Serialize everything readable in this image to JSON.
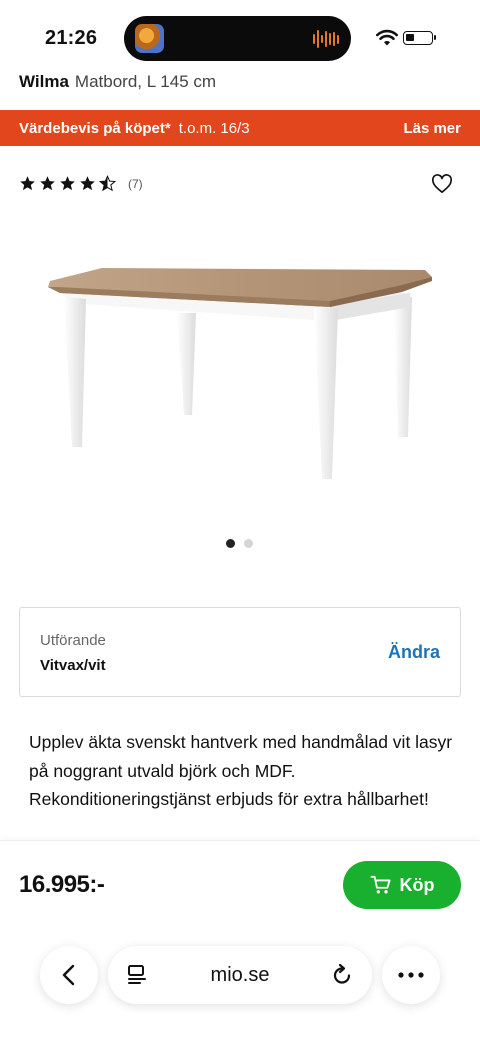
{
  "status_bar": {
    "time": "21:26"
  },
  "product": {
    "brand": "Wilma",
    "name": "Matbord, L 145 cm",
    "rating": 4.5,
    "review_count": "(7)",
    "description": "Upplev äkta svenskt hantverk med handmålad vit lasyr på noggrant utvald björk och MDF. Rekonditioneringstjänst erbjuds för extra hållbarhet!",
    "price": "16.995:-"
  },
  "promo": {
    "label": "Värdebevis på köpet*",
    "date": "t.o.m. 16/3",
    "link": "Läs mer",
    "color": "#e1461c"
  },
  "carousel": {
    "total": 2,
    "active": 1
  },
  "variant": {
    "label": "Utförande",
    "value": "Vitvax/vit",
    "change_label": "Ändra",
    "link_color": "#1f73b7"
  },
  "buy": {
    "label": "Köp",
    "color": "#19b02f"
  },
  "browser": {
    "url": "mio.se"
  },
  "icons": [
    "wifi-icon",
    "battery-icon",
    "star-icon",
    "heart-icon",
    "cart-icon",
    "back-icon",
    "reader-icon",
    "reload-icon",
    "more-icon"
  ]
}
